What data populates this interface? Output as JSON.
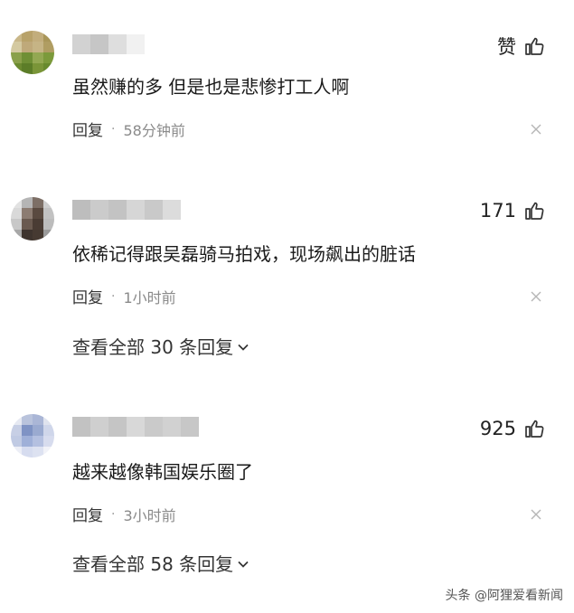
{
  "comments": [
    {
      "likes": "赞",
      "text": "虽然赚的多 但是也是悲惨打工人啊",
      "reply": "回复",
      "time": "58分钟前"
    },
    {
      "likes": "171",
      "text": "依稀记得跟吴磊骑马拍戏，现场飙出的脏话",
      "reply": "回复",
      "time": "1小时前",
      "view_all": "查看全部 30 条回复"
    },
    {
      "likes": "925",
      "text": "越来越像韩国娱乐圈了",
      "reply": "回复",
      "time": "3小时前",
      "view_all": "查看全部 58 条回复"
    }
  ],
  "icons": {
    "like": "thumbs-up-outline-icon",
    "close": "close-x-icon",
    "expand": "chevron-down-icon"
  },
  "watermark": "头条 @阿狸爱看新闻",
  "colors": {
    "text": "#1a1a1a",
    "meta": "#8a8a8a",
    "icon": "#333333"
  }
}
